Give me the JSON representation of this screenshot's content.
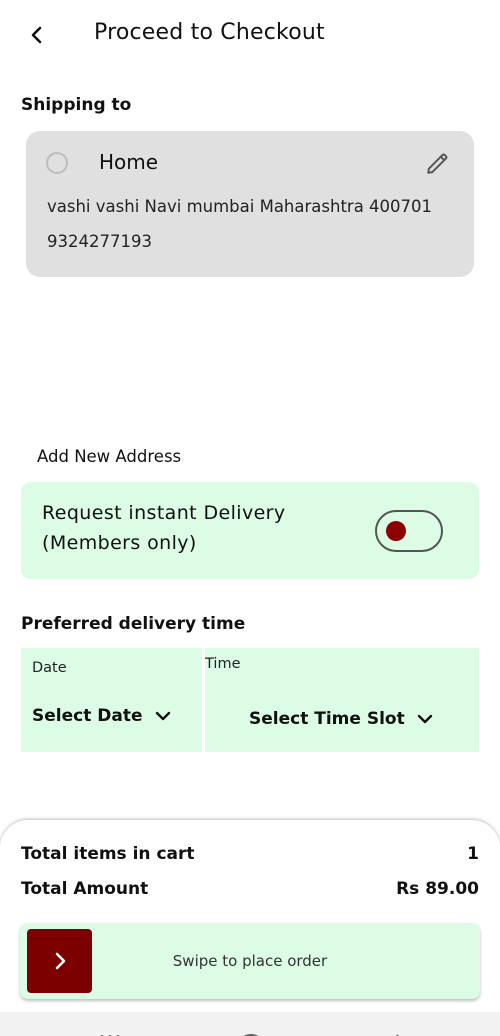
{
  "header": {
    "title": "Proceed to Checkout",
    "back_icon": "chevron-left-icon"
  },
  "shipping": {
    "section_title": "Shipping to",
    "address": {
      "label": "Home",
      "line": "vashi vashi Navi mumbai Maharashtra 400701",
      "phone": "9324277193",
      "selected": false,
      "edit_icon": "pencil-icon"
    },
    "add_new_label": "Add New Address"
  },
  "instant_delivery": {
    "line1": "Request instant Delivery",
    "line2": "(Members only)",
    "enabled": false
  },
  "delivery_time": {
    "section_title": "Preferred delivery time",
    "date": {
      "label": "Date",
      "select_text": "Select Date"
    },
    "time": {
      "label": "Time",
      "select_text": "Select Time Slot"
    }
  },
  "summary": {
    "items_label": "Total items in cart",
    "items_value": "1",
    "amount_label": "Total Amount",
    "amount_value": "Rs 89.00"
  },
  "swipe": {
    "text": "Swipe to place order",
    "icon": "chevron-right-icon"
  },
  "colors": {
    "accent": "#7d0000",
    "mint": "#dcfce6",
    "card_gray": "#e0e0e0"
  }
}
